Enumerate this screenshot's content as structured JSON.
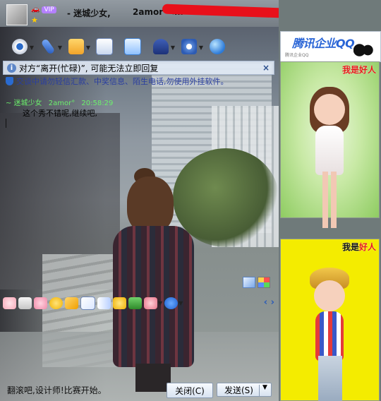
{
  "titlebar": {
    "vip_text": "VIP",
    "name": "- 迷城少女,",
    "id_prefix": "2amor°<m",
    "buttons": {
      "minimize": "–",
      "maximize": "+",
      "close": "×"
    }
  },
  "toolbar": {
    "items": [
      {
        "icon": "webcam-icon"
      },
      {
        "icon": "microphone-icon"
      },
      {
        "icon": "folder-icon"
      },
      {
        "icon": "email-icon"
      },
      {
        "icon": "add-message-icon"
      },
      {
        "icon": "police-cap-icon"
      },
      {
        "icon": "settings-icon"
      },
      {
        "icon": "globe-icon"
      }
    ]
  },
  "notice": {
    "text": "对方“离开(忙碌)”, 可能无法立即回复",
    "close": "×"
  },
  "warning": {
    "text": "交谈中请勿轻信汇款、中奖信息、陌生电话,勿使用外挂软件。"
  },
  "chat": {
    "sender": "~ 迷城少女",
    "sender2": "2amor°",
    "time": "20:58:29",
    "message": "这个秀不错呢,继续吧,"
  },
  "emoticon_bar": {
    "items": [
      "pig-face-icon",
      "cup-icon",
      "pink-pig-icon",
      "emoji-icon",
      "thumb-icon",
      "doodle-icon",
      "bow-icon",
      "duck-icon",
      "gift-icon",
      "mug-icon",
      "sogou-icon"
    ],
    "prev": "‹",
    "next": "›"
  },
  "bottom": {
    "tip": "翻滚吧,设计师!比赛开始。",
    "close_button": "关闭(C)",
    "send_button": "发送(S)",
    "send_dropdown": "▼"
  },
  "right_panel": {
    "ad_brand": "腾讯企业QQ",
    "ad_small": "腾讯企业QQ",
    "show1_label_a": "我是",
    "show1_label_b": "好人",
    "show2_label_a": "我是",
    "show2_label_b": "好人"
  },
  "colors": {
    "accent_blue": "#2a3ea0",
    "alert_red": "#e71919",
    "show_green": "#8fcc62",
    "show_yellow": "#f4ec00"
  }
}
